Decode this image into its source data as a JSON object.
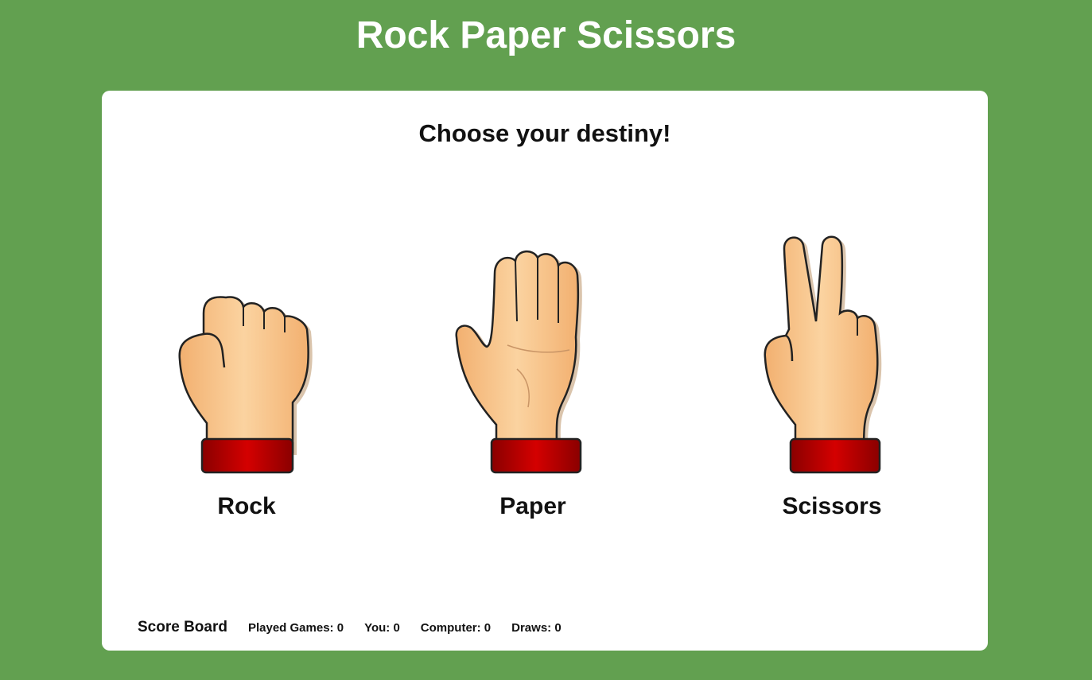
{
  "header": {
    "title": "Rock Paper Scissors"
  },
  "game": {
    "prompt": "Choose your destiny!",
    "choices": [
      {
        "label": "Rock",
        "icon": "rock-hand-icon"
      },
      {
        "label": "Paper",
        "icon": "paper-hand-icon"
      },
      {
        "label": "Scissors",
        "icon": "scissors-hand-icon"
      }
    ]
  },
  "scoreboard": {
    "title": "Score Board",
    "played_label": "Played Games:",
    "played": "0",
    "you_label": "You:",
    "you": "0",
    "computer_label": "Computer:",
    "computer": "0",
    "draws_label": "Draws:",
    "draws": "0"
  },
  "colors": {
    "background": "#62a050",
    "card": "#ffffff",
    "skin": "#f7c080",
    "cuff": "#b30000"
  }
}
